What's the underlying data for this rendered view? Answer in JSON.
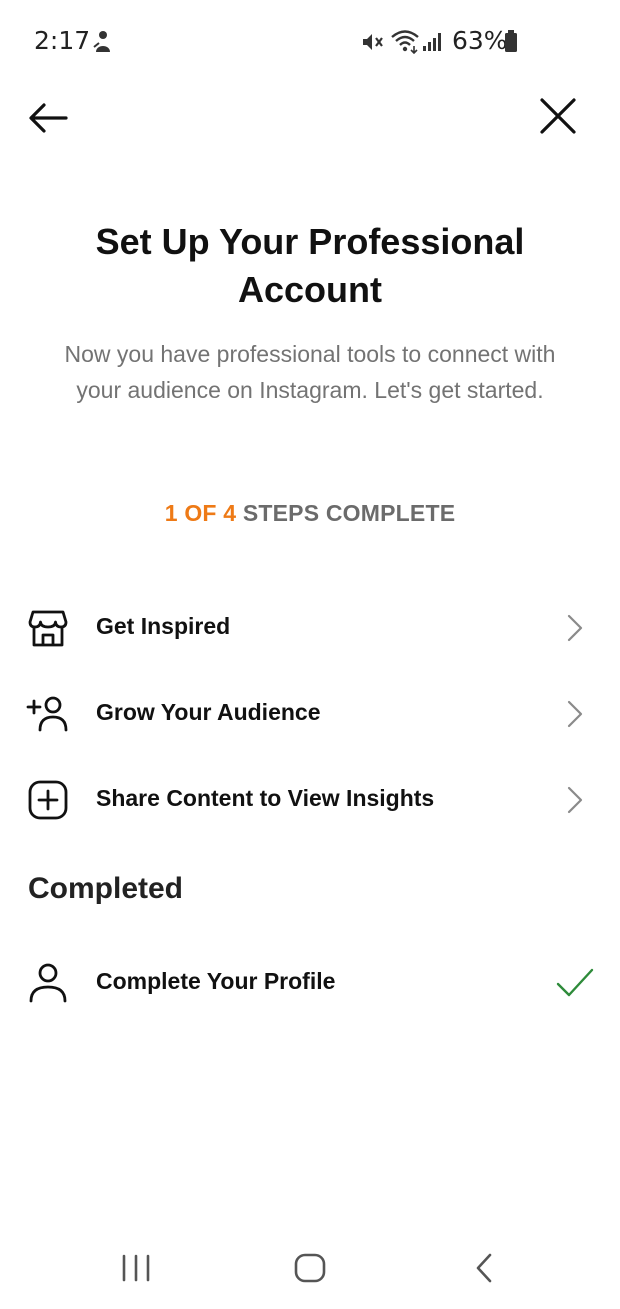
{
  "status_bar": {
    "time": "2:17",
    "battery": "63%"
  },
  "header": {
    "title": "Set Up Your Professional Account",
    "subtitle": "Now you have professional tools to connect with your audience on Instagram. Let's get started.",
    "progress_done": "1 OF 4",
    "progress_rest": " STEPS COMPLETE"
  },
  "steps": [
    {
      "label": "Get Inspired",
      "icon": "shop-icon"
    },
    {
      "label": "Grow Your Audience",
      "icon": "add-person-icon"
    },
    {
      "label": "Share Content to View Insights",
      "icon": "plus-square-icon"
    }
  ],
  "completed": {
    "heading": "Completed",
    "items": [
      {
        "label": "Complete Your Profile",
        "icon": "person-icon"
      }
    ]
  },
  "colors": {
    "accent_orange": "#ee7a16",
    "check_green": "#2e8b3a",
    "subtitle_gray": "#737373"
  }
}
